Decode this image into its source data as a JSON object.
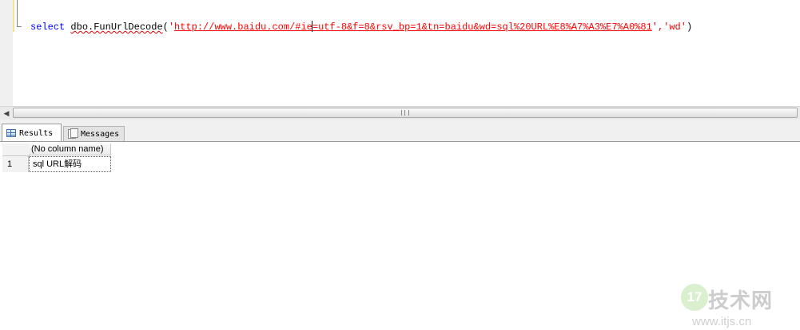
{
  "editor": {
    "keyword": "select",
    "function_name": "dbo.FunUrlDecode",
    "open_paren": "(",
    "quote_open": "'",
    "url_before_caret": "http://www.baidu.com/#ie",
    "url_after_caret": "=utf-8&f=8&rsv_bp=1&tn=baidu&wd=sql%20URL%E8%A7%A3%E7%A0%81",
    "arg_rest": "','wd'",
    "close_paren": ")"
  },
  "results_pane": {
    "tabs": [
      {
        "label": "Results",
        "icon": "grid-icon",
        "active": true
      },
      {
        "label": "Messages",
        "icon": "messages-icon",
        "active": false
      }
    ],
    "grid": {
      "columns": [
        "(No column name)"
      ],
      "rows": [
        {
          "row_number": "1",
          "cells": [
            "sql URL解码"
          ]
        }
      ]
    }
  },
  "scrollbar": {
    "left_arrow_icon": "chevron-left-icon"
  },
  "watermark": {
    "badge": "17",
    "title": "技术网",
    "url": "www.itjs.cn"
  }
}
